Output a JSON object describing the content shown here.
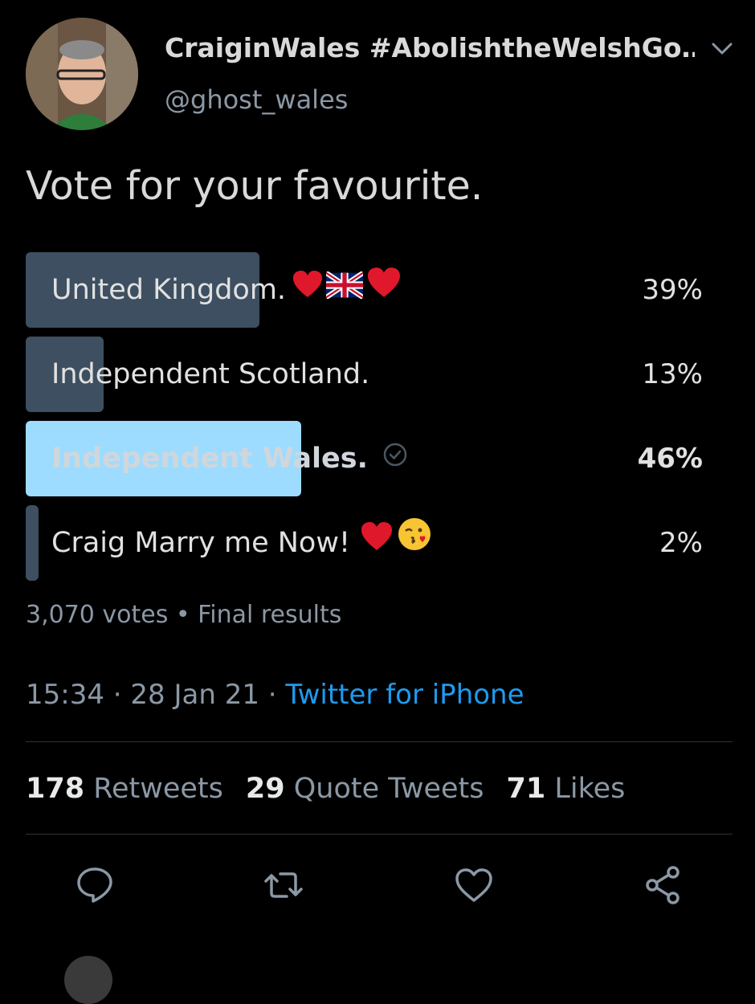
{
  "tweet": {
    "display_name": "CraiginWales #AbolishtheWelshGo…",
    "handle": "@ghost_wales",
    "text": "Vote for your favourite."
  },
  "poll": {
    "options": [
      {
        "label": "United Kingdom.",
        "percent": "39%",
        "value": 39,
        "emoji": [
          "red-heart",
          "uk-flag",
          "red-heart"
        ],
        "winner": false
      },
      {
        "label": "Independent Scotland.",
        "percent": "13%",
        "value": 13,
        "emoji": [],
        "winner": false
      },
      {
        "label": "Independent Wales.",
        "percent": "46%",
        "value": 46,
        "emoji": [],
        "winner": true
      },
      {
        "label": "Craig Marry me Now!",
        "percent": "2%",
        "value": 2,
        "emoji": [
          "red-heart",
          "face-blowing-kiss"
        ],
        "winner": false
      }
    ],
    "votes": "3,070 votes",
    "status": "Final results",
    "separator": " • "
  },
  "meta": {
    "time": "15:34",
    "date": "28 Jan 21",
    "source": "Twitter for iPhone",
    "sep": " · "
  },
  "stats": {
    "retweets_count": "178",
    "retweets_label": "Retweets",
    "quotes_count": "29",
    "quotes_label": "Quote Tweets",
    "likes_count": "71",
    "likes_label": "Likes"
  },
  "colors": {
    "background": "#000000",
    "bar": "#3d4f60",
    "winner_bar": "#9ddcff",
    "link": "#1d9bf0",
    "muted": "#8b98a5"
  }
}
